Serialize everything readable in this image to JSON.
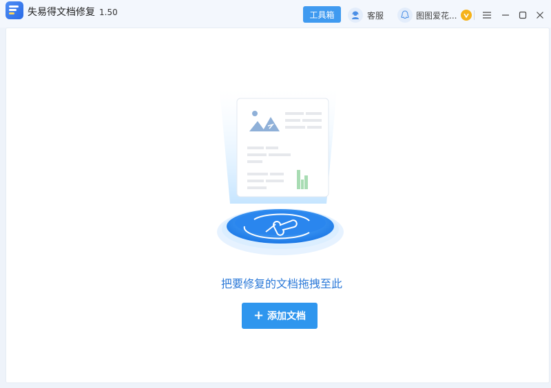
{
  "app": {
    "title": "失易得文档修复",
    "version": "1.50"
  },
  "header": {
    "toolbox_label": "工具箱",
    "service_label": "客服",
    "user_name": "图图爱花..."
  },
  "main": {
    "drop_hint": "把要修复的文档拖拽至此",
    "add_button_label": "添加文档",
    "add_button_icon": "+"
  },
  "colors": {
    "accent": "#2f96ee",
    "hint_text": "#2a78d8",
    "toolbox_button": "#3f9af0",
    "vip_badge": "#f5b21a"
  },
  "icons": [
    "app-logo",
    "headset-icon",
    "user-avatar-icon",
    "vip-badge-icon",
    "menu-icon",
    "minimize-icon",
    "maximize-icon",
    "close-icon",
    "document-repair-illustration"
  ]
}
